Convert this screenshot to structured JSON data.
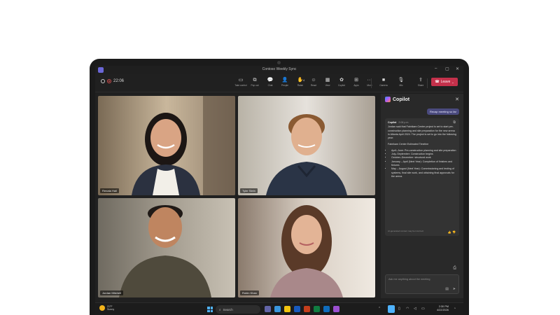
{
  "window": {
    "title": "Contoso Weekly Sync"
  },
  "toolbar": {
    "timer": "22:06",
    "buttons": [
      {
        "icon": "take-control-icon",
        "glyph": "▭",
        "label": "Take control"
      },
      {
        "icon": "pop-out-icon",
        "glyph": "⧉",
        "label": "Pop out"
      },
      {
        "icon": "chat-icon",
        "glyph": "💬",
        "label": "Chat"
      },
      {
        "icon": "people-icon",
        "glyph": "👤",
        "label": "People"
      },
      {
        "icon": "raise-hand-icon",
        "glyph": "✋",
        "label": "Raise"
      },
      {
        "icon": "react-icon",
        "glyph": "☺",
        "label": "React"
      },
      {
        "icon": "view-icon",
        "glyph": "▦",
        "label": "View"
      },
      {
        "icon": "copilot-icon",
        "glyph": "✿",
        "label": "Copilot"
      },
      {
        "icon": "apps-icon",
        "glyph": "⊞",
        "label": "Apps"
      },
      {
        "icon": "more-icon",
        "glyph": "···",
        "label": "More"
      },
      {
        "icon": "camera-icon",
        "glyph": "■",
        "label": "Camera"
      },
      {
        "icon": "mic-icon",
        "glyph": "🎙",
        "label": "Mic"
      },
      {
        "icon": "share-icon",
        "glyph": "⇪",
        "label": "Share"
      }
    ],
    "people_count": "4",
    "leave_label": "Leave"
  },
  "participants": [
    {
      "name": "Renata Hall"
    },
    {
      "name": "Tyler Stein"
    },
    {
      "name": "Jordan Mitchell"
    },
    {
      "name": "Robin Khan"
    }
  ],
  "copilot": {
    "title": "Copilot",
    "user_prompt": "Recap meeting so far",
    "response": {
      "author": "Copilot",
      "time": "2:08 p.m.",
      "summary": "Jordan said that Fabrikam Center project is set to start pre-construction planning and site preparation for the new arena in Atlanta April 2024. The project is set to go into the following year:",
      "timeline_title": "Fabrikam Center Estimated Timeline",
      "timeline": [
        "April–June: Pre-construction planning and site preparation",
        "July–September: Construction begins",
        "October–December: structural work",
        "January – April (Next Year): Completion of finishes and fixtures",
        "May – August (Next Year): Commissioning and testing of systems, final site work, and obtaining final approvals for the arena."
      ],
      "reference": "AI-generated content may be incorrect"
    },
    "input_placeholder": "Ask me anything about the meeting"
  },
  "taskbar": {
    "weather_temp": "21°F",
    "weather_desc": "Sunny",
    "search_placeholder": "Search",
    "time": "2:30 PM",
    "date": "4/22/2026"
  }
}
